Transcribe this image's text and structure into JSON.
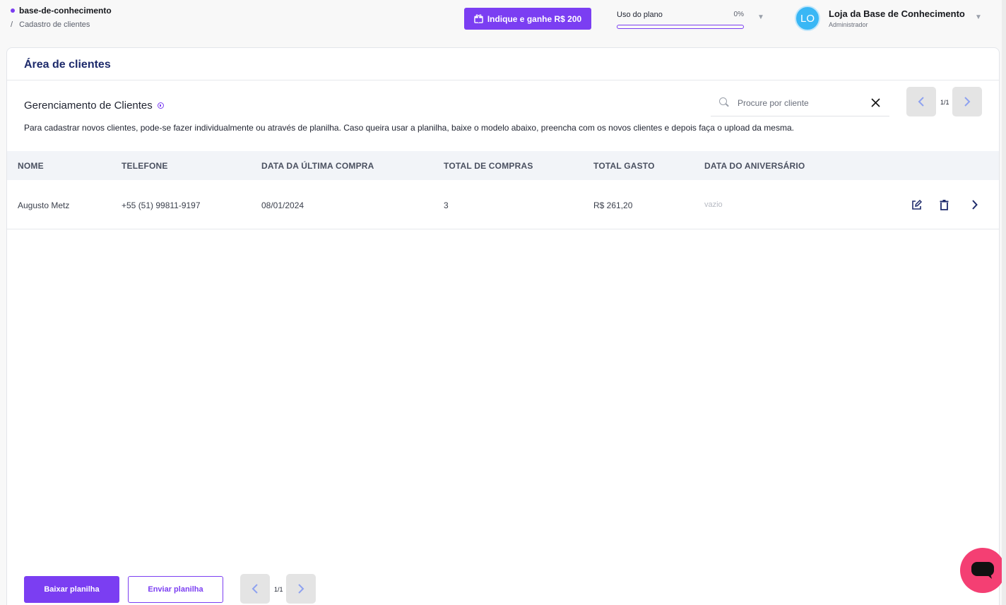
{
  "breadcrumb": {
    "root": "base-de-conhecimento",
    "separator": "/",
    "current": "Cadastro de clientes"
  },
  "referral_button": {
    "label": "Indique e ganhe R$ 200",
    "icon": "gift-icon"
  },
  "plan_usage": {
    "label": "Uso do plano",
    "percent_label": "0%",
    "fraction": 0.0
  },
  "user": {
    "initials": "LO",
    "name": "Loja da Base de Conhecimento",
    "role": "Administrador"
  },
  "page": {
    "title": "Área de clientes",
    "section_title": "Gerenciamento de Clientes",
    "description": "Para cadastrar novos clientes, pode-se fazer individualmente ou através de planilha. Caso queira usar a planilha, baixe o modelo abaixo, preencha com os novos clientes e depois faça o upload da mesma."
  },
  "search": {
    "placeholder": "Procure por cliente",
    "value": ""
  },
  "pagination_top": {
    "label": "1/1"
  },
  "pagination_bottom": {
    "label": "1/1"
  },
  "table": {
    "columns": [
      "NOME",
      "TELEFONE",
      "DATA DA ÚLTIMA COMPRA",
      "TOTAL DE COMPRAS",
      "TOTAL GASTO",
      "DATA DO ANIVERSÁRIO"
    ],
    "rows": [
      {
        "name": "Augusto Metz",
        "phone": "+55 (51) 99811-9197",
        "last_purchase": "08/01/2024",
        "total_purchases": "3",
        "total_spent": "R$ 261,20",
        "birthday": "vazio"
      }
    ]
  },
  "actions": {
    "download_label": "Baixar planilha",
    "upload_label": "Enviar planilha"
  },
  "colors": {
    "accent": "#7b3ef2",
    "title": "#1d2a6b",
    "chat": "#f43f73",
    "avatar": "#39b7f5"
  }
}
